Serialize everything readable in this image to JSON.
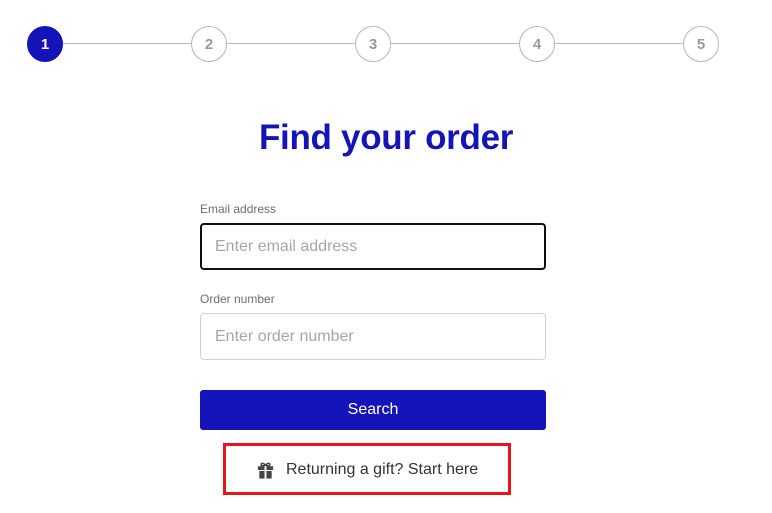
{
  "stepper": {
    "steps": [
      {
        "label": "1",
        "active": true
      },
      {
        "label": "2",
        "active": false
      },
      {
        "label": "3",
        "active": false
      },
      {
        "label": "4",
        "active": false
      },
      {
        "label": "5",
        "active": false
      }
    ]
  },
  "page": {
    "title": "Find your order"
  },
  "form": {
    "email": {
      "label": "Email address",
      "placeholder": "Enter email address",
      "value": ""
    },
    "order_number": {
      "label": "Order number",
      "placeholder": "Enter order number",
      "value": ""
    },
    "search_label": "Search"
  },
  "gift": {
    "icon": "gift-icon",
    "label": "Returning a gift? Start here"
  },
  "colors": {
    "brand": "#1414b8",
    "highlight": "#e8141c"
  }
}
